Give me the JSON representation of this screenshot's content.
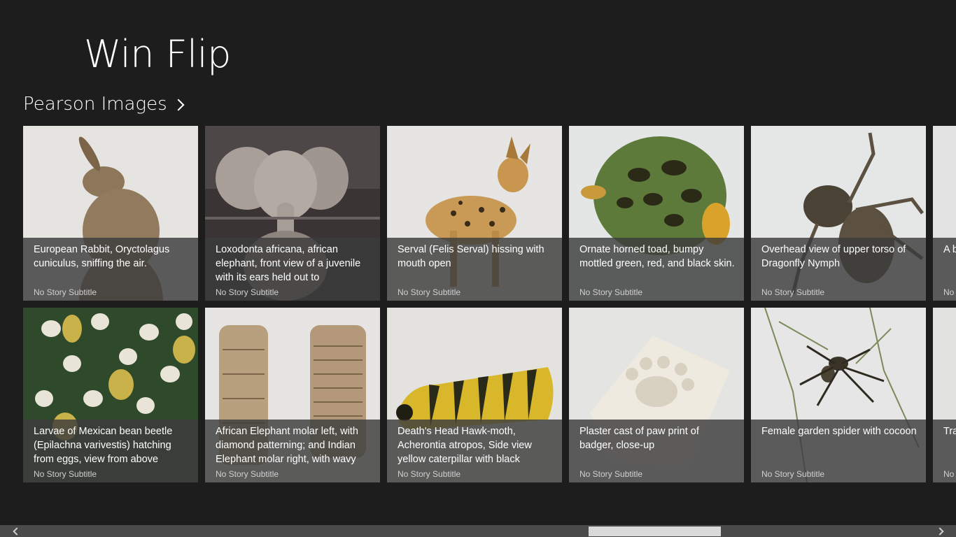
{
  "app": {
    "title": "Win Flip"
  },
  "section": {
    "title": "Pearson Images"
  },
  "tiles": [
    {
      "title": "European Rabbit, Oryctolagus cuniculus, sniffing the air.",
      "subtitle": "No Story Subtitle",
      "image_icon": "rabbit-photo"
    },
    {
      "title": "Loxodonta africana, african elephant, front view of a juvenile with its ears held out to",
      "subtitle": "No Story Subtitle",
      "image_icon": "elephant-photo"
    },
    {
      "title": "Serval (Felis Serval) hissing with mouth open",
      "subtitle": "No Story Subtitle",
      "image_icon": "serval-photo"
    },
    {
      "title": "Ornate horned toad, bumpy mottled green, red, and black skin.",
      "subtitle": "No Story Subtitle",
      "image_icon": "toad-photo"
    },
    {
      "title": "Overhead view of upper torso of Dragonfly Nymph",
      "subtitle": "No Story Subtitle",
      "image_icon": "nymph-photo"
    },
    {
      "title": "A b",
      "subtitle": "No",
      "image_icon": "partial-photo"
    },
    {
      "title": "Larvae of Mexican bean beetle (Epilachna varivestis) hatching from eggs, view from above",
      "subtitle": "No Story Subtitle",
      "image_icon": "larvae-photo"
    },
    {
      "title": "African Elephant molar left, with diamond patterning; and Indian Elephant molar right, with wavy",
      "subtitle": "No Story Subtitle",
      "image_icon": "molar-photo"
    },
    {
      "title": "Death's Head Hawk-moth, Acherontia atropos, Side view yellow caterpillar with black",
      "subtitle": "No Story Subtitle",
      "image_icon": "caterpillar-photo"
    },
    {
      "title": "Plaster cast of paw print of badger, close-up",
      "subtitle": "No Story Subtitle",
      "image_icon": "paw-cast-photo"
    },
    {
      "title": "Female garden spider with cocoon",
      "subtitle": "No Story Subtitle",
      "image_icon": "spider-photo"
    },
    {
      "title": "Tra Mu Co",
      "subtitle": "No",
      "image_icon": "partial-photo"
    }
  ],
  "scrollbar": {
    "left_icon": "chevron-left-icon",
    "right_icon": "chevron-right-icon"
  }
}
